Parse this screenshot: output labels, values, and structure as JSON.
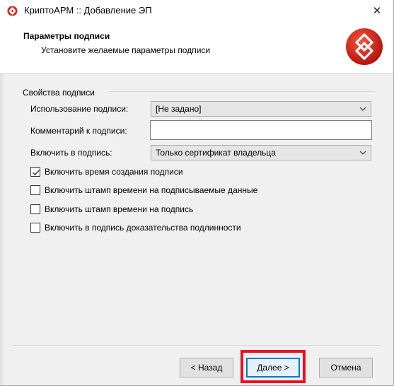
{
  "window": {
    "title": "КриптоАРМ :: Добавление ЭП",
    "close_glyph": "✕"
  },
  "header": {
    "title": "Параметры подписи",
    "subtitle": "Установите желаемые параметры подписи"
  },
  "group": {
    "label": "Свойства подписи"
  },
  "fields": {
    "usage_label": "Использование подписи:",
    "usage_value": "[Не задано]",
    "comment_label": "Комментарий к подписи:",
    "comment_value": "",
    "include_label": "Включить в подпись:",
    "include_value": "Только сертификат владельца"
  },
  "checkboxes": [
    {
      "label": "Включить время создания подписи",
      "checked": true
    },
    {
      "label": "Включить штамп времени на подписываемые данные",
      "checked": false
    },
    {
      "label": "Включить штамп времени на подпись",
      "checked": false
    },
    {
      "label": "Включить в подпись доказательства подлинности",
      "checked": false
    }
  ],
  "buttons": {
    "back": "< Назад",
    "next": "Далее >",
    "cancel": "Отмена"
  },
  "colors": {
    "logo_red": "#d9261c",
    "highlight": "#e81123",
    "accent": "#0078d7"
  },
  "icons": {
    "app": "cryptoarm-logo-icon",
    "close": "close-icon",
    "dropdown": "chevron-down-icon",
    "check": "checkmark-icon"
  }
}
